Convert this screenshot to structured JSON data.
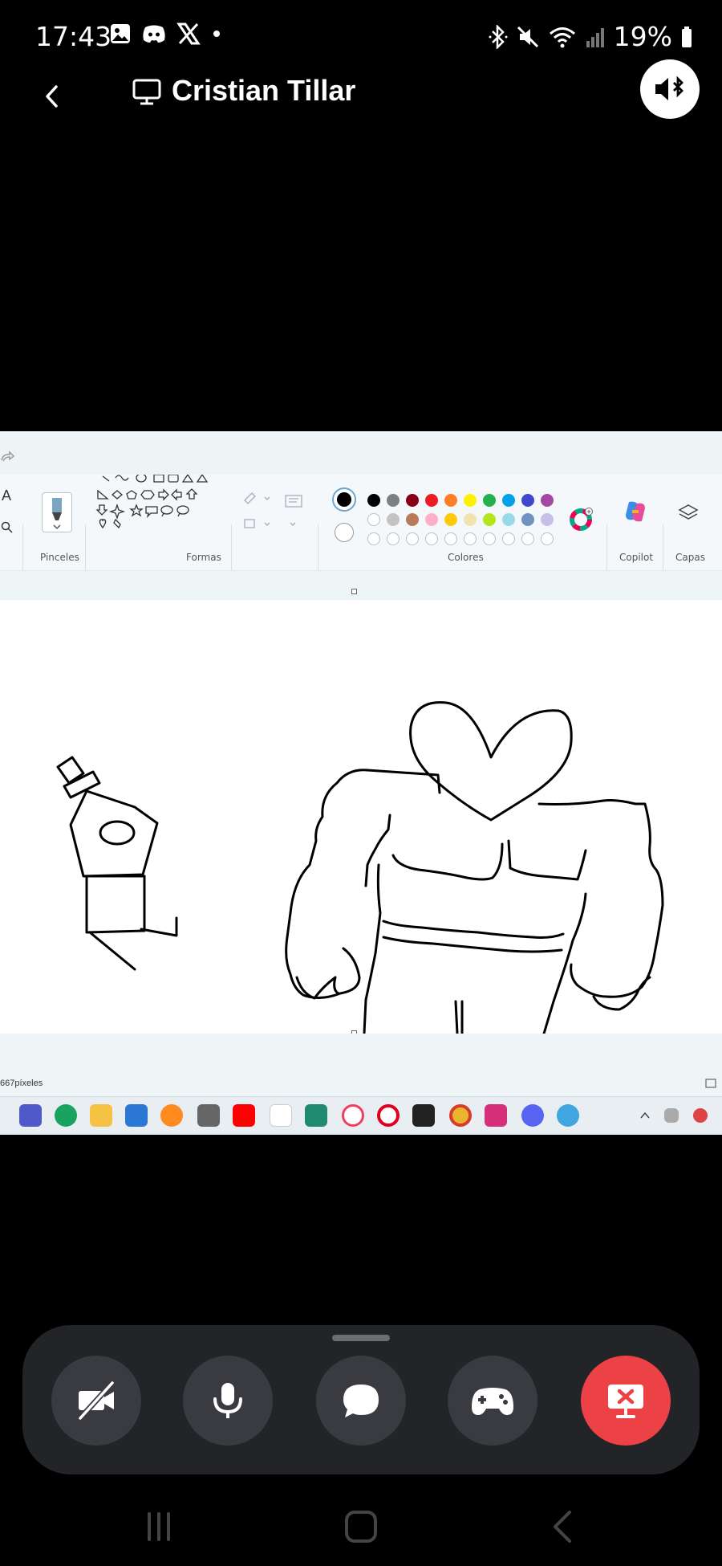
{
  "status_bar": {
    "time": "17:43",
    "battery": "19%",
    "left_icons": [
      "gallery-icon",
      "discord-icon",
      "x-icon",
      "dot-icon"
    ],
    "right_icons": [
      "bluetooth-icon",
      "mute-icon",
      "wifi-icon",
      "signal-icon",
      "battery-icon"
    ]
  },
  "header": {
    "caller_name": "Cristian Tillar"
  },
  "paint": {
    "ribbon_labels": {
      "brushes": "Pinceles",
      "shapes": "Formas",
      "colors": "Colores",
      "copilot": "Copilot",
      "layers": "Capas"
    },
    "tool_letter": "A",
    "pixel_readout": "667píxeles",
    "palette_row1": [
      "#000000",
      "#7f7f7f",
      "#880015",
      "#ed1c24",
      "#ff7f27",
      "#fff200",
      "#22b14c",
      "#00a2e8",
      "#3f48cc",
      "#a349a4"
    ],
    "palette_row2": [
      "#ffffff",
      "#c3c3c3",
      "#b97a57",
      "#ffaec9",
      "#ffc90e",
      "#efe4b0",
      "#b5e61d",
      "#99d9ea",
      "#7092be",
      "#c8bfe7"
    ],
    "taskbar_icons": [
      "windows-icon",
      "teams-icon",
      "edge-icon",
      "folder-icon",
      "store-icon",
      "firefox-icon",
      "app-m-icon",
      "youtube-icon",
      "amazon-icon",
      "pycharm-icon",
      "opera-gx-icon",
      "opera-icon",
      "play-store-icon",
      "chrome-icon",
      "instagram-icon",
      "discord-icon",
      "paint-icon"
    ]
  },
  "call_controls": {
    "buttons": [
      "camera-off-icon",
      "microphone-icon",
      "chat-icon",
      "gamepad-icon",
      "stop-share-icon"
    ]
  },
  "colors": {
    "end_red": "#ed4245",
    "tray_bg": "#232428",
    "button_bg": "#3a3b40"
  }
}
